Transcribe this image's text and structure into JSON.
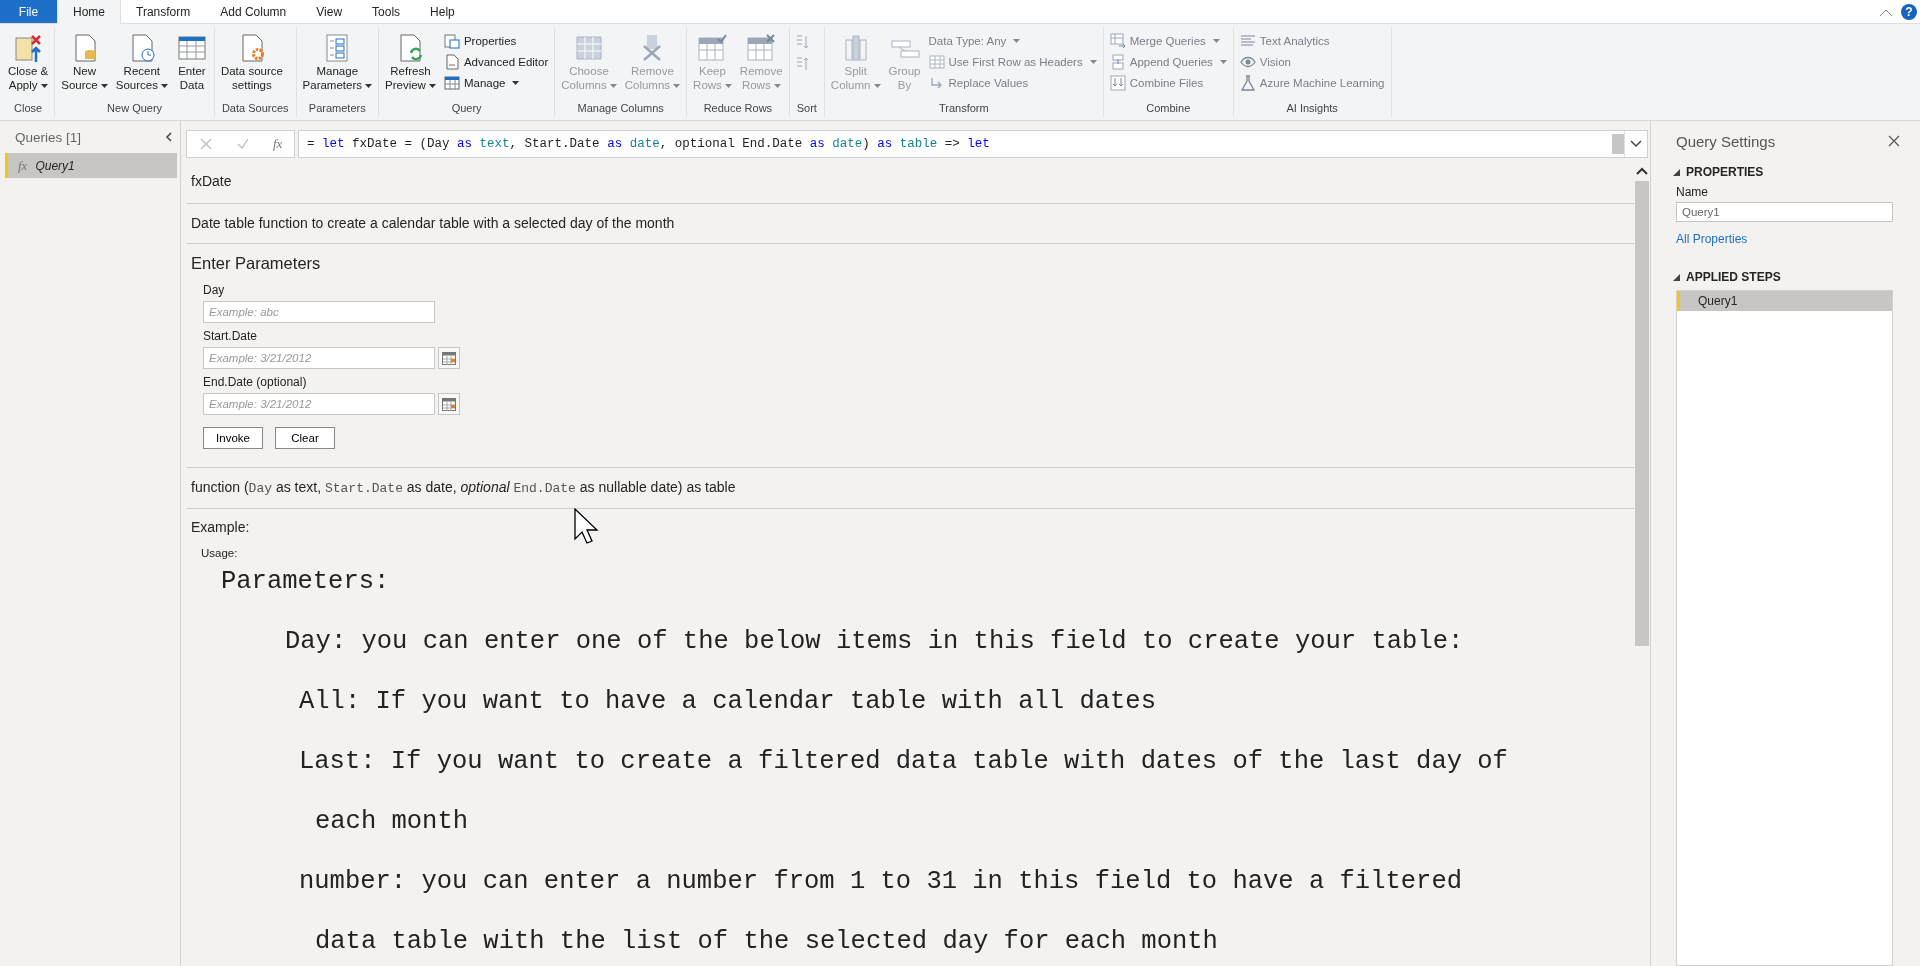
{
  "ribbon_tabs": [
    {
      "label": "File",
      "kind": "file",
      "selected": false
    },
    {
      "label": "Home",
      "kind": "tab",
      "selected": true
    },
    {
      "label": "Transform",
      "kind": "tab",
      "selected": false
    },
    {
      "label": "Add Column",
      "kind": "tab",
      "selected": false
    },
    {
      "label": "View",
      "kind": "tab",
      "selected": false
    },
    {
      "label": "Tools",
      "kind": "tab",
      "selected": false
    },
    {
      "label": "Help",
      "kind": "tab",
      "selected": false
    }
  ],
  "help_button": {
    "label": "?"
  },
  "ribbon_groups": [
    {
      "label": "Close",
      "items": [
        {
          "kind": "large",
          "lines": [
            "Close &",
            "Apply"
          ],
          "dropdown": true,
          "disabled": false
        }
      ]
    },
    {
      "label": "New Query",
      "items": [
        {
          "kind": "large",
          "lines": [
            "New",
            "Source"
          ],
          "dropdown": true,
          "disabled": false
        },
        {
          "kind": "large",
          "lines": [
            "Recent",
            "Sources"
          ],
          "dropdown": true,
          "disabled": false
        },
        {
          "kind": "large",
          "lines": [
            "Enter",
            "Data"
          ],
          "dropdown": false,
          "disabled": false
        }
      ]
    },
    {
      "label": "Data Sources",
      "items": [
        {
          "kind": "large",
          "lines": [
            "Data source",
            "settings"
          ],
          "dropdown": false,
          "disabled": false
        }
      ]
    },
    {
      "label": "Parameters",
      "items": [
        {
          "kind": "large",
          "lines": [
            "Manage",
            "Parameters"
          ],
          "dropdown": true,
          "disabled": false
        }
      ]
    },
    {
      "label": "Query",
      "items": [
        {
          "kind": "large",
          "lines": [
            "Refresh",
            "Preview"
          ],
          "dropdown": true,
          "disabled": false
        },
        {
          "kind": "stack",
          "items": [
            {
              "label": "Properties",
              "dropdown": false,
              "disabled": false
            },
            {
              "label": "Advanced Editor",
              "dropdown": false,
              "disabled": false
            },
            {
              "label": "Manage",
              "dropdown": true,
              "disabled": false
            }
          ]
        }
      ]
    },
    {
      "label": "Manage Columns",
      "items": [
        {
          "kind": "large",
          "lines": [
            "Choose",
            "Columns"
          ],
          "dropdown": true,
          "disabled": true
        },
        {
          "kind": "large",
          "lines": [
            "Remove",
            "Columns"
          ],
          "dropdown": true,
          "disabled": true
        }
      ]
    },
    {
      "label": "Reduce Rows",
      "items": [
        {
          "kind": "large",
          "lines": [
            "Keep",
            "Rows"
          ],
          "dropdown": true,
          "disabled": true
        },
        {
          "kind": "large",
          "lines": [
            "Remove",
            "Rows"
          ],
          "dropdown": true,
          "disabled": true
        }
      ]
    },
    {
      "label": "Sort",
      "items": [
        {
          "kind": "sort",
          "disabled": true
        }
      ]
    },
    {
      "label": "Transform",
      "items": [
        {
          "kind": "large",
          "lines": [
            "Split",
            "Column"
          ],
          "dropdown": true,
          "disabled": true
        },
        {
          "kind": "large",
          "lines": [
            "Group",
            "By"
          ],
          "dropdown": false,
          "disabled": true
        },
        {
          "kind": "stack",
          "items": [
            {
              "label": "Data Type: Any",
              "dropdown": true,
              "disabled": true
            },
            {
              "label": "Use First Row as Headers",
              "dropdown": true,
              "disabled": true
            },
            {
              "label": "Replace Values",
              "dropdown": false,
              "disabled": true
            }
          ]
        }
      ]
    },
    {
      "label": "Combine",
      "items": [
        {
          "kind": "stack",
          "items": [
            {
              "label": "Merge Queries",
              "dropdown": true,
              "disabled": true
            },
            {
              "label": "Append Queries",
              "dropdown": true,
              "disabled": true
            },
            {
              "label": "Combine Files",
              "dropdown": false,
              "disabled": true
            }
          ]
        }
      ]
    },
    {
      "label": "AI Insights",
      "items": [
        {
          "kind": "stack",
          "items": [
            {
              "label": "Text Analytics",
              "dropdown": false,
              "disabled": true
            },
            {
              "label": "Vision",
              "dropdown": false,
              "disabled": true
            },
            {
              "label": "Azure Machine Learning",
              "dropdown": false,
              "disabled": true
            }
          ]
        }
      ]
    }
  ],
  "queries_panel": {
    "title": "Queries [1]",
    "items": [
      {
        "icon_text": "fx",
        "name": "Query1",
        "selected": true
      }
    ]
  },
  "formula_bar": {
    "fx_label": "fx",
    "tokens": [
      {
        "text": "= ",
        "kind": "plain"
      },
      {
        "text": "let",
        "kind": "keyword"
      },
      {
        "text": " fxDate = (Day ",
        "kind": "plain"
      },
      {
        "text": "as",
        "kind": "keyword"
      },
      {
        "text": " text",
        "kind": "type"
      },
      {
        "text": ", Start.Date ",
        "kind": "plain"
      },
      {
        "text": "as",
        "kind": "keyword"
      },
      {
        "text": " date",
        "kind": "type"
      },
      {
        "text": ", optional End.Date ",
        "kind": "plain"
      },
      {
        "text": "as",
        "kind": "keyword"
      },
      {
        "text": " date",
        "kind": "type"
      },
      {
        "text": ") ",
        "kind": "plain"
      },
      {
        "text": "as",
        "kind": "keyword"
      },
      {
        "text": " table",
        "kind": "type"
      },
      {
        "text": " => ",
        "kind": "plain"
      },
      {
        "text": "let",
        "kind": "keyword"
      }
    ]
  },
  "function": {
    "name": "fxDate",
    "description": "Date table function to create a calendar table with a selected day of the month",
    "parameters_title": "Enter Parameters",
    "parameters": [
      {
        "label": "Day",
        "placeholder": "Example: abc",
        "kind": "text"
      },
      {
        "label": "Start.Date",
        "placeholder": "Example: 3/21/2012",
        "kind": "date"
      },
      {
        "label": "End.Date (optional)",
        "placeholder": "Example: 3/21/2012",
        "kind": "date"
      }
    ],
    "buttons": [
      "Invoke",
      "Clear"
    ],
    "signature": [
      {
        "text": "function (",
        "kind": "plain"
      },
      {
        "text": "Day",
        "kind": "code"
      },
      {
        "text": " as text, ",
        "kind": "plain"
      },
      {
        "text": "Start.Date",
        "kind": "code"
      },
      {
        "text": " as date, ",
        "kind": "plain"
      },
      {
        "text": "optional ",
        "kind": "italic"
      },
      {
        "text": "End.Date",
        "kind": "code"
      },
      {
        "text": " as nullable date) as table",
        "kind": "plain"
      }
    ],
    "example_title": "Example:",
    "usage_label": "Usage:",
    "usage_lines": [
      {
        "text": "Parameters:",
        "kind": "heading"
      },
      {
        "text": "Day: you can enter one of the below items in this field to create your table:",
        "kind": "param"
      },
      {
        "text": "All: If you want to have a calendar table with all dates",
        "kind": "option"
      },
      {
        "text": "Last: If you want to create a filtered data table with dates of the last day of",
        "kind": "option"
      },
      {
        "text": "each month",
        "kind": "continuation"
      },
      {
        "text": "number: you can enter a number from 1 to 31 in this field to have a filtered",
        "kind": "option"
      },
      {
        "text": "data table with the list of the selected day for each month",
        "kind": "continuation"
      }
    ]
  },
  "query_settings": {
    "title": "Query Settings",
    "properties_title": "PROPERTIES",
    "name_label": "Name",
    "name_value": "Query1",
    "all_properties": "All Properties",
    "applied_steps_title": "APPLIED STEPS",
    "steps": [
      {
        "label": "Query1",
        "selected": true
      }
    ]
  }
}
